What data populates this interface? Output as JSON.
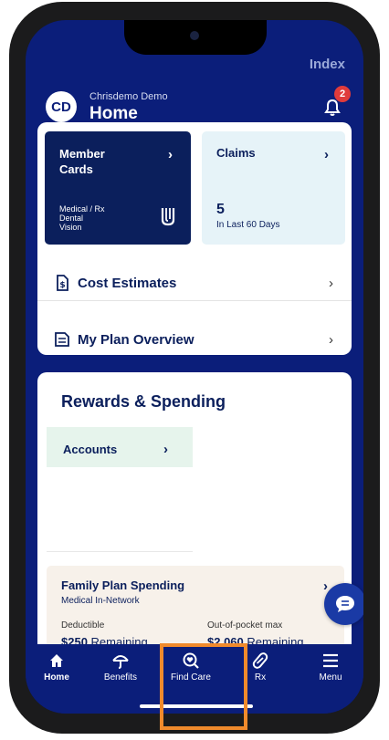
{
  "header": {
    "index_label": "Index",
    "avatar_initials": "CD",
    "user_name": "Chrisdemo Demo",
    "page_title": "Home",
    "notification_count": "2"
  },
  "member_cards": {
    "title": "Member Cards",
    "plans": [
      "Medical / Rx",
      "Dental",
      "Vision"
    ]
  },
  "claims": {
    "title": "Claims",
    "count": "5",
    "subtitle": "In Last 60 Days"
  },
  "rows": [
    {
      "label": "Cost Estimates",
      "icon": "dollar-document-icon"
    },
    {
      "label": "My Plan Overview",
      "icon": "document-icon"
    }
  ],
  "rewards": {
    "title": "Rewards & Spending",
    "accounts_label": "Accounts"
  },
  "family_plan": {
    "title": "Family Plan Spending",
    "subtitle": "Medical In-Network",
    "deductible_label": "Deductible",
    "deductible_value": "$250",
    "deductible_suffix": "Remaining",
    "oop_label": "Out-of-pocket max",
    "oop_value": "$2,060",
    "oop_suffix": "Remaining"
  },
  "nav": [
    {
      "label": "Home",
      "icon": "home-icon",
      "active": true
    },
    {
      "label": "Benefits",
      "icon": "umbrella-icon",
      "active": false
    },
    {
      "label": "Find Care",
      "icon": "search-heart-icon",
      "active": false
    },
    {
      "label": "Rx",
      "icon": "pill-icon",
      "active": false
    },
    {
      "label": "Menu",
      "icon": "hamburger-icon",
      "active": false
    }
  ],
  "colors": {
    "brand_navy": "#0b1e7a",
    "card_navy": "#0b1f5c",
    "claims_bg": "#e6f3f8",
    "accounts_bg": "#e6f4ec",
    "family_bg": "#f7f1ea",
    "badge_red": "#e03b3b",
    "highlight_orange": "#f08a2c"
  }
}
